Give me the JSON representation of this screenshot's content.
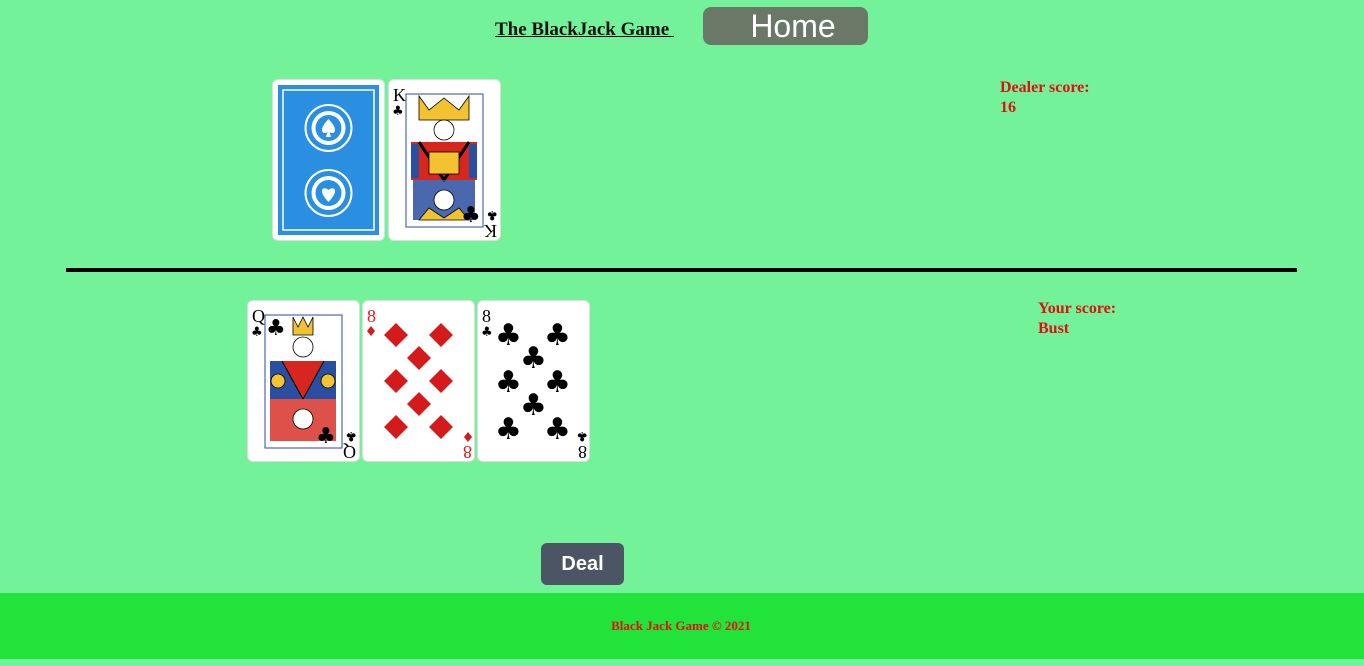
{
  "header": {
    "title": "The BlackJack Game ",
    "home_label": "Home"
  },
  "dealer": {
    "score_label": "Dealer score:",
    "score_value": "16",
    "cards": [
      {
        "face": "back"
      },
      {
        "rank": "K",
        "suit": "clubs"
      }
    ]
  },
  "player": {
    "score_label": "Your score:",
    "score_value": "Bust",
    "cards": [
      {
        "rank": "Q",
        "suit": "clubs"
      },
      {
        "rank": "8",
        "suit": "diamonds"
      },
      {
        "rank": "8",
        "suit": "clubs"
      }
    ]
  },
  "controls": {
    "deal_label": "Deal"
  },
  "footer": {
    "copyright": "Black Jack Game © 2021"
  },
  "colors": {
    "background": "#74f29a",
    "footer": "#22e33a",
    "score_text": "#e01010",
    "card_back": "#2a8fe0"
  }
}
